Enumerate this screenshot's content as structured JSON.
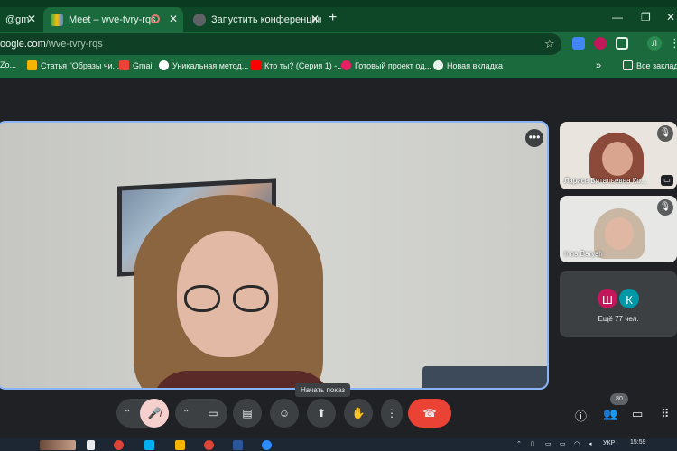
{
  "browser": {
    "tabs": [
      {
        "label": "@gm",
        "active": false
      },
      {
        "label": "Meet – wve-tvry-rqs",
        "active": true
      },
      {
        "label": "Запустить конференцию - Zoo",
        "active": false
      }
    ],
    "new_tab": "+",
    "url_host": "oogle.com",
    "url_path": "/wve-tvry-rqs",
    "profile_initial": "Л"
  },
  "bookmarks": [
    {
      "label": "Zo..."
    },
    {
      "label": "Статья \"Образы чи..."
    },
    {
      "label": "Gmail"
    },
    {
      "label": "Уникальная метод..."
    },
    {
      "label": "Кто ты? (Серия 1) -..."
    },
    {
      "label": "Готовый проект од..."
    },
    {
      "label": "Новая вкладка"
    },
    {
      "label": "Все закладк"
    }
  ],
  "bookmarks_more": "»",
  "meet": {
    "participants": [
      {
        "name": "Лариса Витальевна Ко..."
      },
      {
        "name": "Inna Barysh"
      }
    ],
    "more_avatars": [
      {
        "initial": "Ш",
        "color": "#c2185b"
      },
      {
        "initial": "К",
        "color": "#0097a7"
      }
    ],
    "more_label": "Ещё 77 чел.",
    "tooltip": "Начать показ",
    "participant_count": "80",
    "colors": {
      "leave": "#ea4335",
      "mic_off": "#f6d0cd",
      "border": "#8ab4f8"
    }
  },
  "taskbar": {
    "time": "15:59",
    "lang": "УКР"
  }
}
